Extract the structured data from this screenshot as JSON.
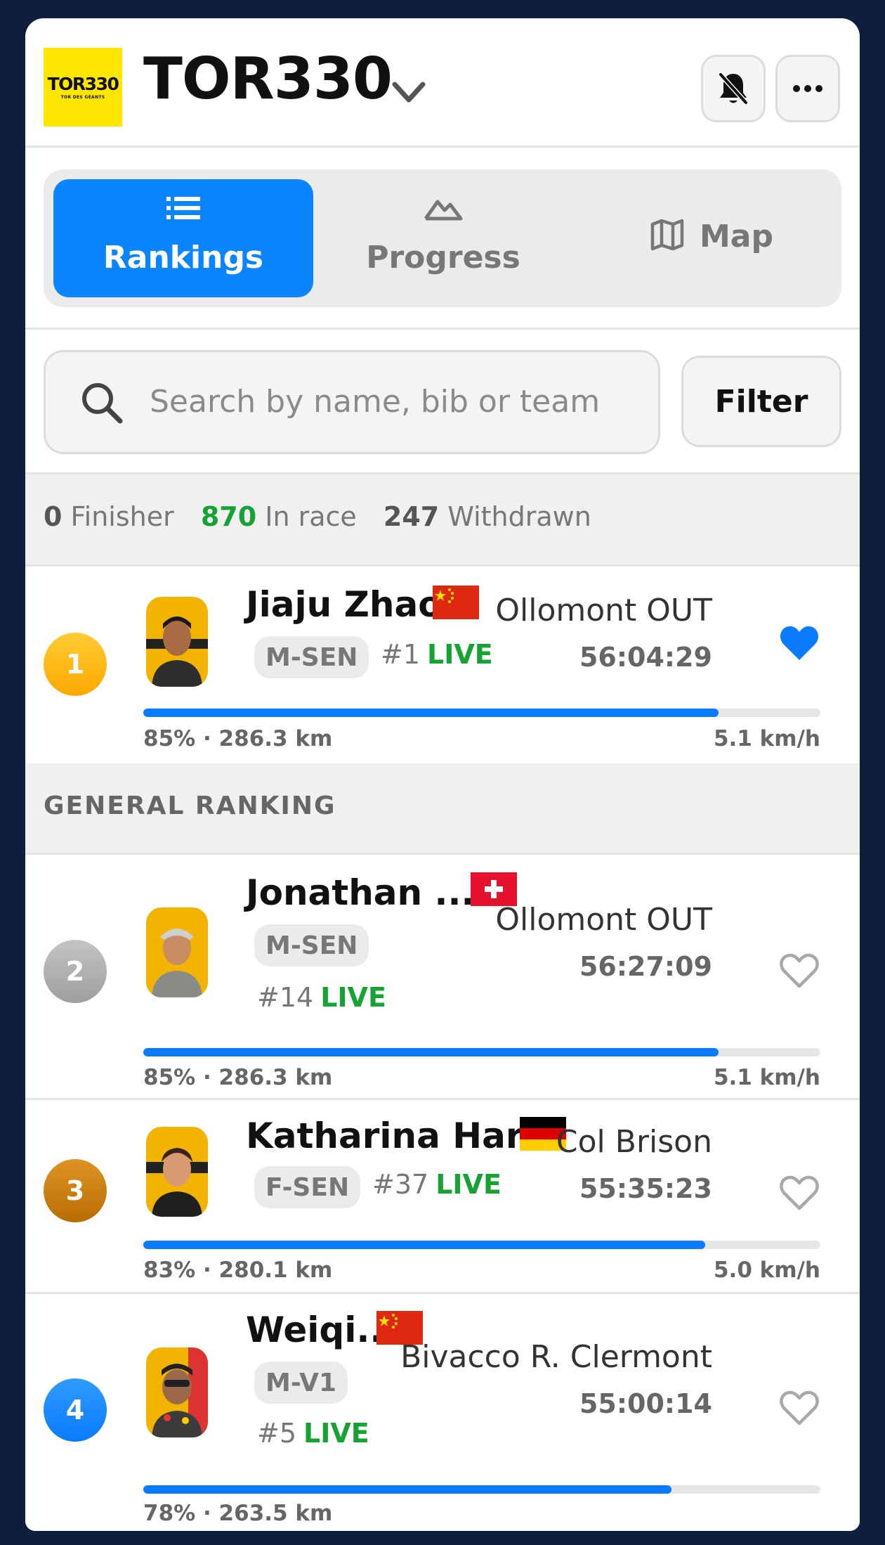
{
  "header": {
    "logo_text": "TOR330",
    "logo_sub": "TOR DES GÉANTS",
    "event_title": "TOR330"
  },
  "tabs": [
    {
      "label": "Rankings",
      "icon": "list-icon",
      "active": true
    },
    {
      "label": "Progress",
      "icon": "mountain-icon",
      "active": false
    },
    {
      "label": "Map",
      "icon": "map-icon",
      "active": false
    }
  ],
  "search": {
    "placeholder": "Search by name, bib or team",
    "value": ""
  },
  "filter_label": "Filter",
  "stats": {
    "finisher_count": "0",
    "finisher_label": "Finisher",
    "in_race_count": "870",
    "in_race_label": "In race",
    "withdrawn_count": "247",
    "withdrawn_label": "Withdrawn"
  },
  "section_title": "GENERAL RANKING",
  "runners": [
    {
      "rank": "1",
      "rank_color": "#ffb100",
      "name": "Jiaju Zhao",
      "flag": "china",
      "category": "M-SEN",
      "bib": "#1",
      "live": "LIVE",
      "location": "Ollomont OUT",
      "time": "56:04:29",
      "favorite": true,
      "progress_pct": 85,
      "progress_text": "85% · 286.3 km",
      "speed": "5.1 km/h"
    },
    {
      "rank": "2",
      "rank_color": "#a8a8a8",
      "name": "Jonathan ...",
      "flag": "switzerland",
      "category": "M-SEN",
      "bib": "#14",
      "live": "LIVE",
      "location": "Ollomont OUT",
      "time": "56:27:09",
      "favorite": false,
      "progress_pct": 85,
      "progress_text": "85% · 286.3 km",
      "speed": "5.1 km/h"
    },
    {
      "rank": "3",
      "rank_color": "#c87a0a",
      "name": "Katharina Har...",
      "flag": "germany",
      "category": "F-SEN",
      "bib": "#37",
      "live": "LIVE",
      "location": "Col Brison",
      "time": "55:35:23",
      "favorite": false,
      "progress_pct": 83,
      "progress_text": "83% · 280.1 km",
      "speed": "5.0 km/h"
    },
    {
      "rank": "4",
      "rank_color": "#0a84ff",
      "name": "Weiqi...",
      "flag": "china",
      "category": "M-V1",
      "bib": "#5",
      "live": "LIVE",
      "location": "Bivacco R. Clermont",
      "time": "55:00:14",
      "favorite": false,
      "progress_pct": 78,
      "progress_text": "78% · 263.5 km",
      "speed": ""
    }
  ],
  "colors": {
    "accent": "#0a84ff",
    "live": "#17a334",
    "bar": "#0a7aff"
  }
}
